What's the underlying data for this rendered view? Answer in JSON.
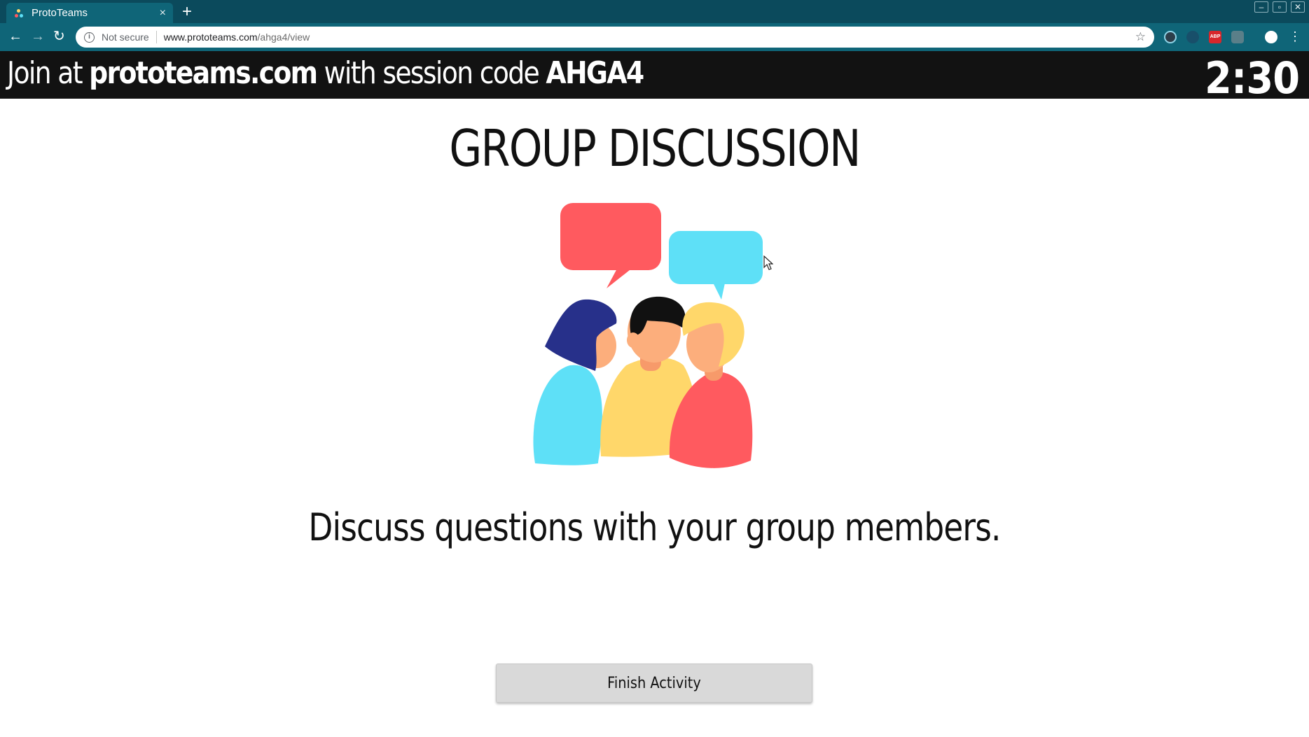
{
  "browser": {
    "tab_title": "ProtoTeams",
    "tab_close": "×",
    "new_tab": "+",
    "window_controls": [
      "–",
      "▫",
      "✕"
    ],
    "nav": {
      "back": "←",
      "forward": "→",
      "reload": "↻"
    },
    "address": {
      "security_label": "Not secure",
      "host": "www.prototeams.com",
      "path": "/ahga4/view"
    },
    "bookmark_icon": "star-icon",
    "extensions": [
      "react-devtools-icon",
      "extension-icon",
      "adblock-plus-icon",
      "download-icon",
      "profile-icon",
      "menu-icon"
    ]
  },
  "banner": {
    "join_prefix": "Join at ",
    "site": "prototeams.com",
    "join_middle": " with session code ",
    "code": "AHGA4",
    "timer": "2:30"
  },
  "activity": {
    "title": "GROUP DISCUSSION",
    "illustration": "group-discussion-illustration",
    "instruction": "Discuss questions with your group members.",
    "finish_label": "Finish Activity"
  },
  "colors": {
    "tabbar": "#0b4a5c",
    "toolbar": "#0f6578",
    "banner": "#121212",
    "bubble_red": "#ff5a5f",
    "bubble_blue": "#5ee0f7",
    "shirt_yellow": "#ffd76a",
    "hair_navy": "#27308a",
    "hair_blonde": "#ffd76a",
    "skin": "#fcae7c"
  }
}
